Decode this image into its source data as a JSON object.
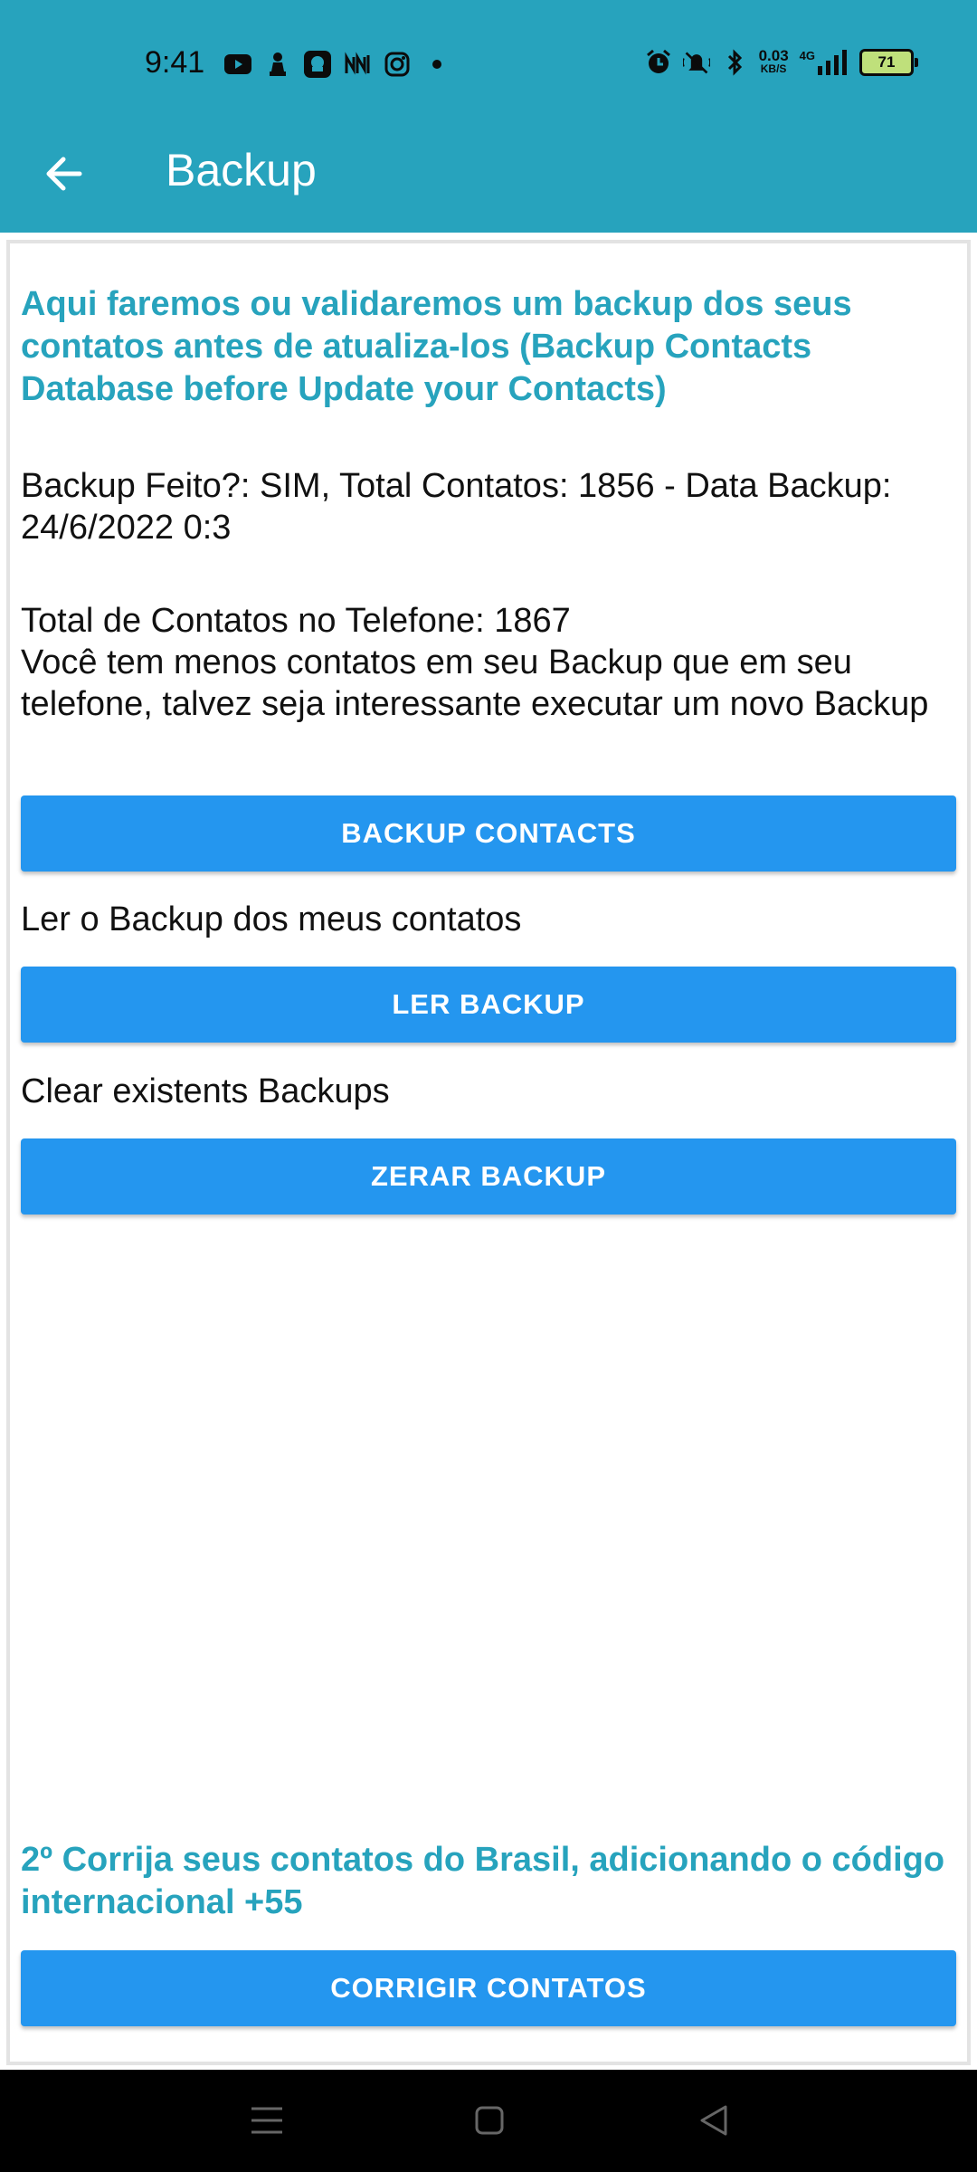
{
  "status_bar": {
    "time": "9:41",
    "net_speed_value": "0.03",
    "net_speed_unit": "KB/S",
    "network_type": "4G",
    "battery": "71"
  },
  "app_bar": {
    "title": "Backup"
  },
  "content": {
    "intro_heading": "Aqui faremos ou validaremos um backup dos seus contatos antes de atualiza-los (Backup Contacts Database before Update your Contacts)",
    "backup_status": "Backup Feito?: SIM, Total Contatos: 1856 - Data Backup: 24/6/2022 0:3",
    "phone_total": "Total de Contatos no Telefone: 1867",
    "phone_advice": "Você tem menos contatos em seu Backup que em seu telefone, talvez seja interessante executar um novo Backup",
    "backup_button": "BACKUP CONTACTS",
    "read_label": "Ler o Backup dos meus contatos",
    "read_button": "LER BACKUP",
    "clear_label": "Clear existents Backups",
    "clear_button": "ZERAR BACKUP",
    "fix_heading": "2º Corrija seus contatos do Brasil, adicionando o código internacional +55",
    "fix_button": "CORRIGIR CONTATOS"
  },
  "colors": {
    "primary": "#27a3bd",
    "button": "#2496ef",
    "nav_bg": "#000000"
  }
}
